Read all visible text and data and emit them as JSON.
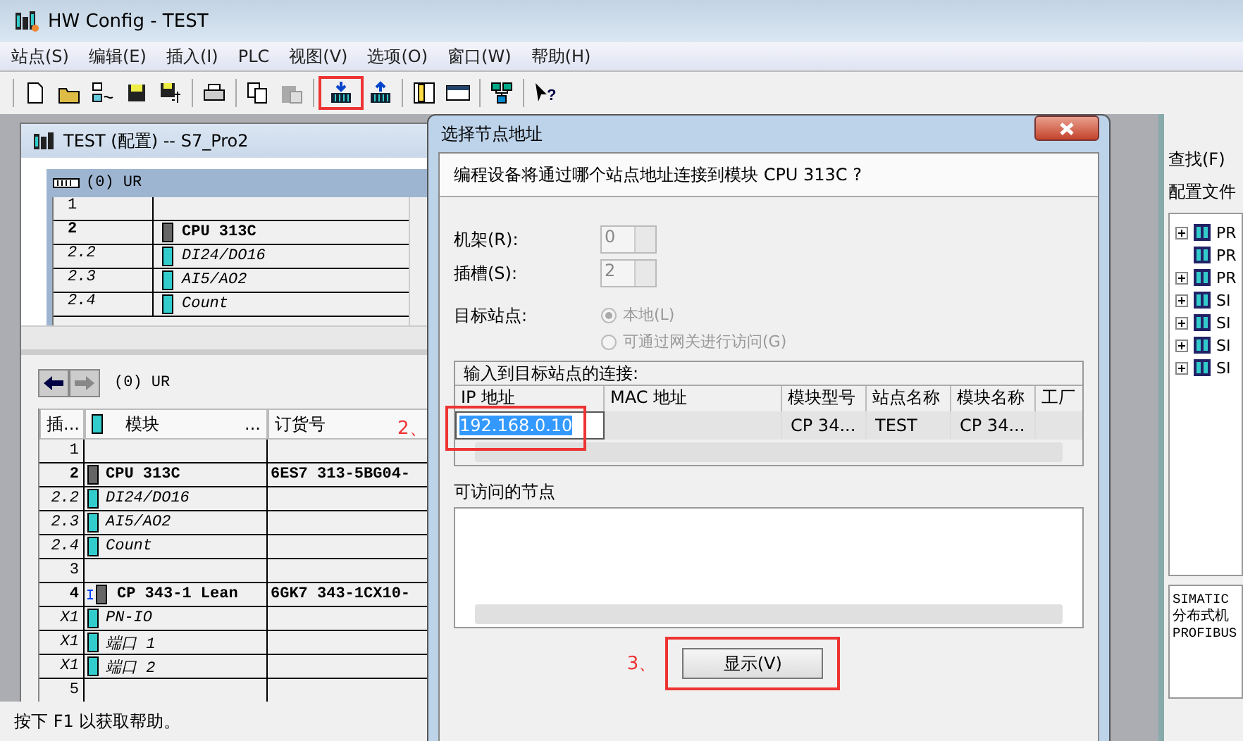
{
  "window": {
    "title": "HW Config - TEST"
  },
  "menu": [
    "站点(S)",
    "编辑(E)",
    "插入(I)",
    "PLC",
    "视图(V)",
    "选项(O)",
    "窗口(W)",
    "帮助(H)"
  ],
  "toolbar": [
    [
      {
        "kind": "new",
        "highlighted": false
      },
      {
        "kind": "open",
        "highlighted": false
      },
      {
        "kind": "network",
        "highlighted": false
      },
      {
        "kind": "save",
        "highlighted": false
      },
      {
        "kind": "compile",
        "highlighted": false
      }
    ],
    [
      {
        "kind": "print",
        "highlighted": false
      }
    ],
    [
      {
        "kind": "copy",
        "highlighted": false
      },
      {
        "kind": "paste",
        "highlighted": false
      }
    ],
    [
      {
        "kind": "download",
        "highlighted": true
      },
      {
        "kind": "upload",
        "highlighted": false
      }
    ],
    [
      {
        "kind": "catalog",
        "highlighted": false
      },
      {
        "kind": "panel",
        "highlighted": false
      }
    ],
    [
      {
        "kind": "netpro",
        "highlighted": false
      }
    ],
    [
      {
        "kind": "help",
        "highlighted": false,
        "glyph": "?"
      }
    ]
  ],
  "station_window": {
    "title": "TEST (配置) -- S7_Pro2",
    "rack": {
      "label": "(0)   UR",
      "rows": [
        {
          "slot": "1",
          "module": "",
          "kind": "empty"
        },
        {
          "slot": "2",
          "module": "CPU 313C",
          "kind": "main"
        },
        {
          "slot": "2.2",
          "module": "DI24/DO16",
          "kind": "sub"
        },
        {
          "slot": "2.3",
          "module": "AI5/AO2",
          "kind": "sub"
        },
        {
          "slot": "2.4",
          "module": "Count",
          "kind": "sub"
        }
      ]
    },
    "detail": {
      "label": "(0)   UR",
      "columns": [
        "插...",
        "模块",
        "...",
        "订货号"
      ],
      "rows": [
        {
          "slot": "1",
          "module": "",
          "order": "",
          "kind": "empty"
        },
        {
          "slot": "2",
          "module": "CPU 313C",
          "order": "6ES7 313-5BG04-",
          "kind": "main"
        },
        {
          "slot": "2.2",
          "module": "DI24/DO16",
          "order": "",
          "kind": "sub"
        },
        {
          "slot": "2.3",
          "module": "AI5/AO2",
          "order": "",
          "kind": "sub"
        },
        {
          "slot": "2.4",
          "module": "Count",
          "order": "",
          "kind": "sub"
        },
        {
          "slot": "3",
          "module": "",
          "order": "",
          "kind": "empty"
        },
        {
          "slot": "4",
          "module": "CP 343-1 Lean",
          "order": "6GK7 343-1CX10-",
          "kind": "net"
        },
        {
          "slot": "X1",
          "module": "PN-IO",
          "order": "",
          "kind": "sub"
        },
        {
          "slot": "X1",
          "module": "端口 1",
          "order": "",
          "kind": "sub"
        },
        {
          "slot": "X1",
          "module": "端口 2",
          "order": "",
          "kind": "sub"
        },
        {
          "slot": "5",
          "module": "",
          "order": "",
          "kind": "empty"
        }
      ]
    }
  },
  "dialog": {
    "title": "选择节点地址",
    "question": "编程设备将通过哪个站点地址连接到模块 CPU 313C ?",
    "rack": {
      "label": "机架(R):",
      "value": "0"
    },
    "slot": {
      "label": "插槽(S):",
      "value": "2"
    },
    "target_label": "目标站点:",
    "target_options": [
      {
        "label": "本地(L)",
        "selected": true,
        "disabled": true
      },
      {
        "label": "可通过网关进行访问(G)",
        "selected": false,
        "disabled": true
      }
    ],
    "connection": {
      "label": "输入到目标站点的连接:",
      "columns": [
        "IP 地址",
        "MAC 地址",
        "模块型号",
        "站点名称",
        "模块名称",
        "工厂"
      ],
      "row": {
        "ip_address": "192.168.0.10",
        "module_type": "CP 34...",
        "station_name": "TEST",
        "module_name": "CP 34..."
      }
    },
    "accessible_label": "可访问的节点",
    "button": "显示(V)"
  },
  "annotations": [
    "2、",
    "3、"
  ],
  "catalog": {
    "find_label": "查找(F)",
    "profile_label": "配置文件",
    "tree": [
      {
        "label": "PR",
        "expandable": true
      },
      {
        "label": "PR",
        "expandable": false
      },
      {
        "label": "PR",
        "expandable": true
      },
      {
        "label": "SI",
        "expandable": true
      },
      {
        "label": "SI",
        "expandable": true
      },
      {
        "label": "SI",
        "expandable": true
      },
      {
        "label": "SI",
        "expandable": true
      }
    ],
    "info": [
      "SIMATIC",
      "分布式机",
      "PROFIBUS"
    ]
  },
  "status_bar": "按下 F1 以获取帮助。"
}
